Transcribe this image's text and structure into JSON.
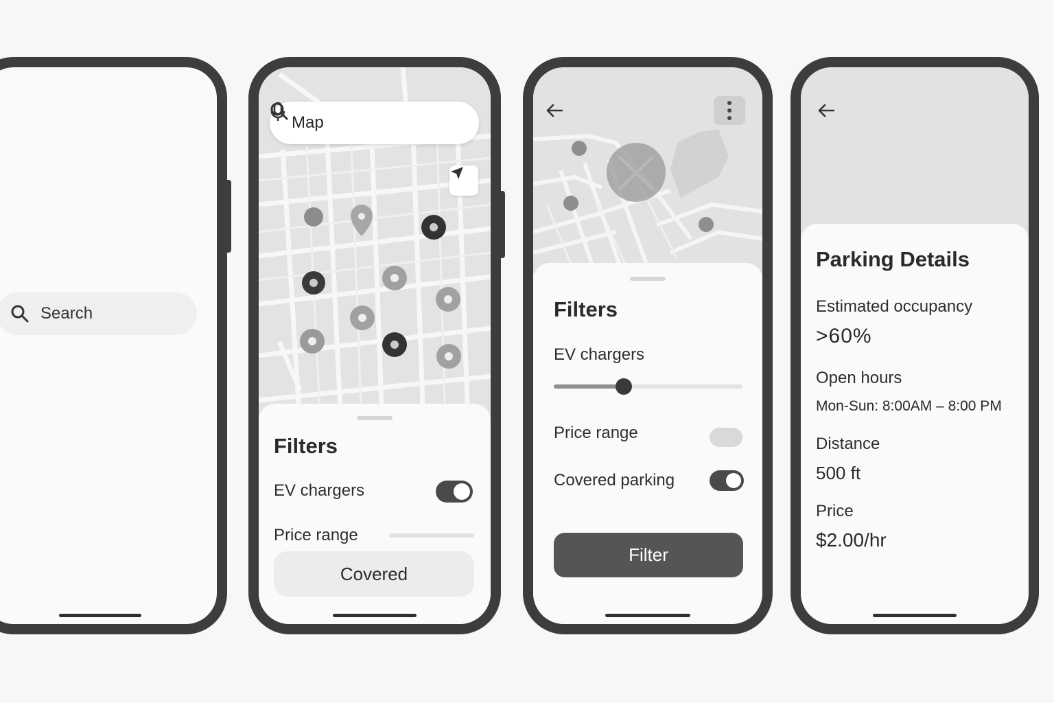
{
  "screen1": {
    "search": {
      "label": "Search",
      "icon": "search-icon"
    }
  },
  "screen2": {
    "search": {
      "label": "Map",
      "icon": "search-icon",
      "mic_icon": "microphone-icon"
    },
    "locate_icon": "navigation-arrow-icon",
    "filters": {
      "title": "Filters",
      "ev_label": "EV chargers",
      "ev_on": true,
      "price_label": "Price range",
      "covered_button": "Covered"
    }
  },
  "screen3": {
    "back_icon": "back-arrow-icon",
    "more_icon": "more-vertical-icon",
    "filters": {
      "title": "Filters",
      "ev_label": "EV chargers",
      "ev_slider_value": 0.37,
      "price_label": "Price range",
      "price_on": false,
      "covered_label": "Covered parking",
      "covered_on": true,
      "filter_button": "Filter"
    }
  },
  "screen4": {
    "back_icon": "back-arrow-icon",
    "title": "Parking Details",
    "occupancy_label": "Estimated occupancy",
    "occupancy_value": ">60%",
    "hours_label": "Open hours",
    "hours_value": "Mon-Sun: 8:00AM – 8:00 PM",
    "distance_label": "Distance",
    "distance_value": "500 ft",
    "price_label": "Price",
    "price_value": "$2.00/hr"
  },
  "colors": {
    "frame": "#3d3d3d",
    "accent": "#4a4a4a",
    "map_bg": "#e3e3e3"
  }
}
